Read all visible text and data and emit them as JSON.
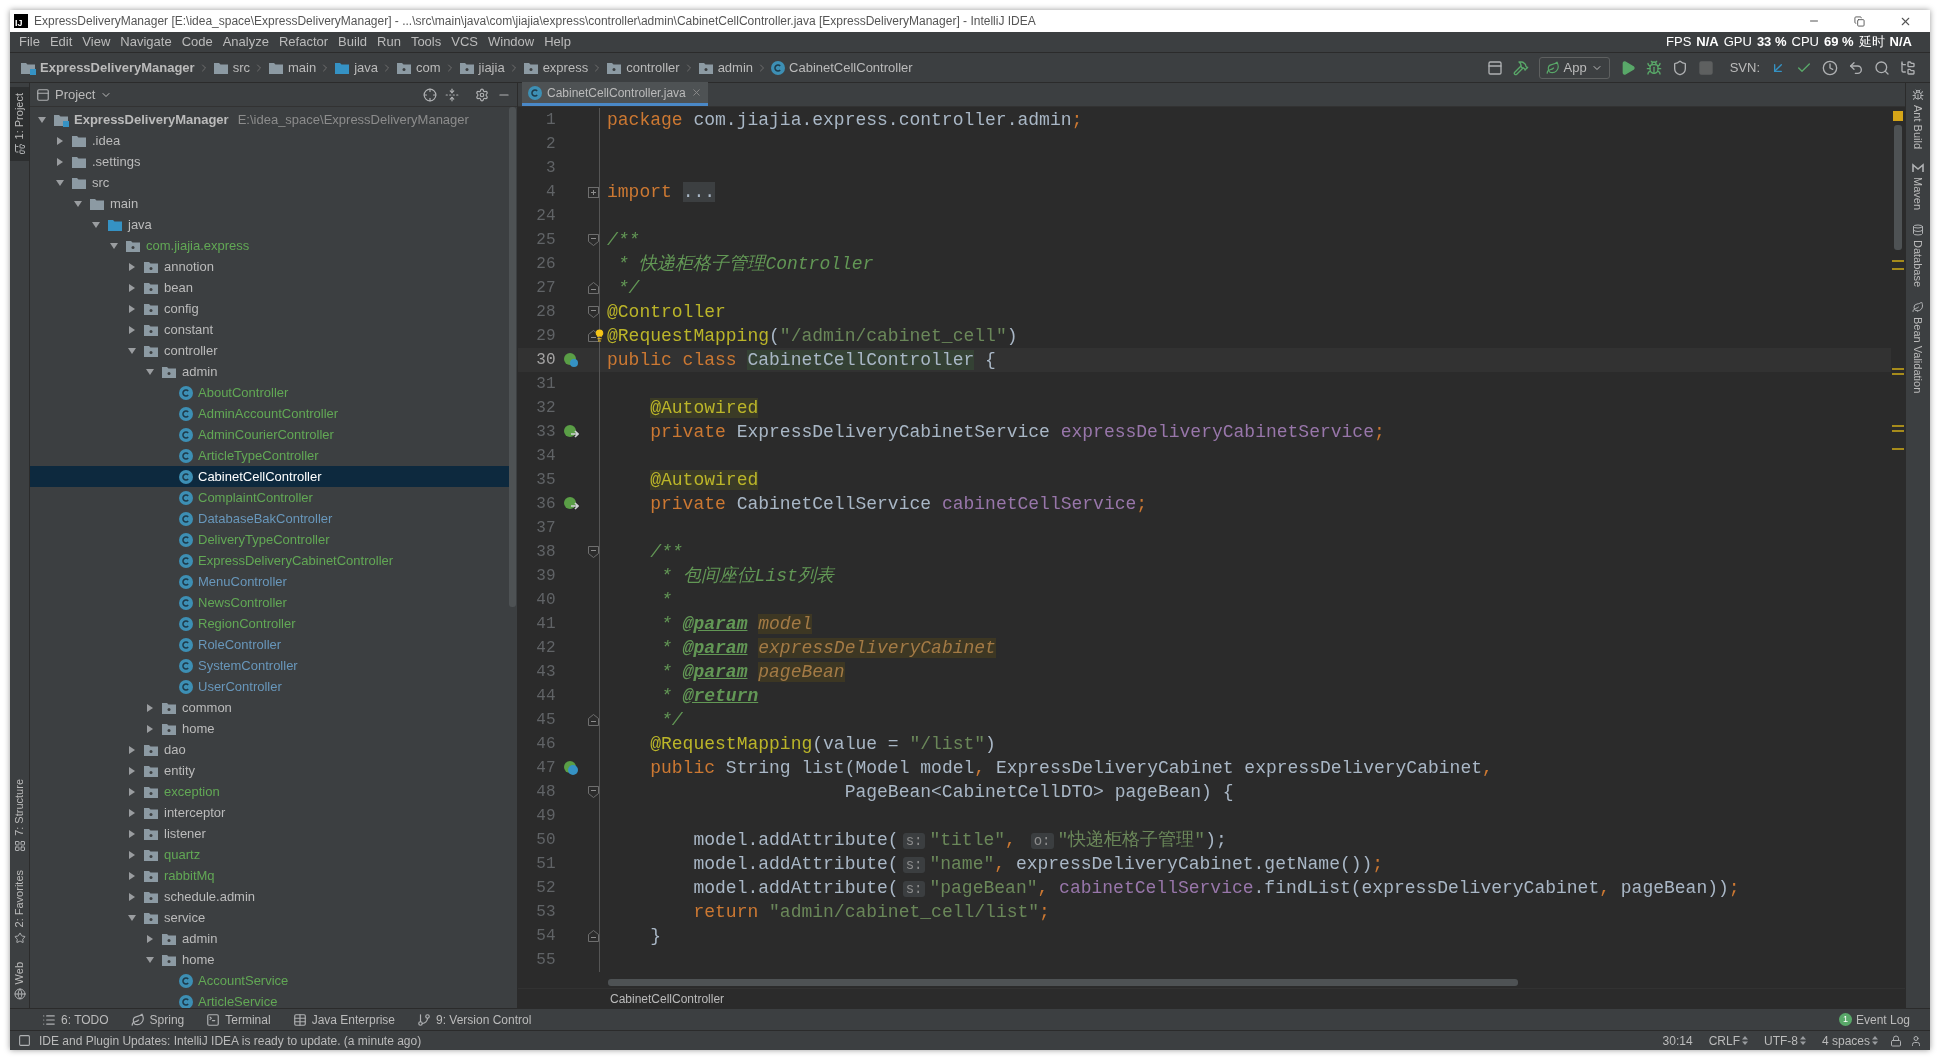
{
  "window": {
    "logo": "IJ",
    "title": "ExpressDeliveryManager [E:\\idea_space\\ExpressDeliveryManager] - ...\\src\\main\\java\\com\\jiajia\\express\\controller\\admin\\CabinetCellController.java [ExpressDeliveryManager] - IntelliJ IDEA"
  },
  "menu": [
    "File",
    "Edit",
    "View",
    "Navigate",
    "Code",
    "Analyze",
    "Refactor",
    "Build",
    "Run",
    "Tools",
    "VCS",
    "Window",
    "Help"
  ],
  "perf": [
    {
      "label": "FPS",
      "value": "N/A"
    },
    {
      "label": "GPU",
      "value": "33 %"
    },
    {
      "label": "CPU",
      "value": "69 %"
    },
    {
      "label": "延时",
      "value": "N/A"
    }
  ],
  "breadcrumbs": [
    {
      "label": "ExpressDeliveryManager",
      "kind": "module"
    },
    {
      "label": "src",
      "kind": "folder"
    },
    {
      "label": "main",
      "kind": "folder"
    },
    {
      "label": "java",
      "kind": "source"
    },
    {
      "label": "com",
      "kind": "package"
    },
    {
      "label": "jiajia",
      "kind": "package"
    },
    {
      "label": "express",
      "kind": "package"
    },
    {
      "label": "controller",
      "kind": "package"
    },
    {
      "label": "admin",
      "kind": "package"
    },
    {
      "label": "CabinetCellController",
      "kind": "class"
    }
  ],
  "toolbar": {
    "run_config": "App",
    "svn_label": "SVN:"
  },
  "left_tools": [
    {
      "label": "1: Project",
      "kind": "project",
      "selected": true
    },
    {
      "label": "7: Structure",
      "kind": "structure",
      "selected": false
    },
    {
      "label": "2: Favorites",
      "kind": "favorites",
      "selected": false
    },
    {
      "label": "Web",
      "kind": "web",
      "selected": false
    }
  ],
  "right_tools": [
    {
      "label": "Ant Build",
      "kind": "ant"
    },
    {
      "label": "Maven",
      "kind": "maven"
    },
    {
      "label": "Database",
      "kind": "database"
    },
    {
      "label": "Bean Validation",
      "kind": "bean"
    }
  ],
  "project_panel": {
    "title": "Project",
    "tree": [
      {
        "label": "ExpressDeliveryManager",
        "path": "E:\\idea_space\\ExpressDeliveryManager",
        "kind": "module",
        "color": "#bbbbbb",
        "selected": false,
        "expanded": true,
        "children": [
          {
            "label": ".idea",
            "kind": "folder",
            "color": "#bbbbbb",
            "selected": false,
            "expanded": false
          },
          {
            "label": ".settings",
            "kind": "folder",
            "color": "#bbbbbb",
            "selected": false,
            "expanded": false
          },
          {
            "label": "src",
            "kind": "folder",
            "color": "#bbbbbb",
            "selected": false,
            "expanded": true,
            "children": [
              {
                "label": "main",
                "kind": "folder",
                "color": "#bbbbbb",
                "selected": false,
                "expanded": true,
                "children": [
                  {
                    "label": "java",
                    "kind": "source",
                    "color": "#bbbbbb",
                    "selected": false,
                    "expanded": true,
                    "children": [
                      {
                        "label": "com.jiajia.express",
                        "kind": "package",
                        "color": "#62a855",
                        "selected": false,
                        "expanded": true,
                        "children": [
                          {
                            "label": "annotion",
                            "kind": "package",
                            "color": "#bbbbbb",
                            "selected": false,
                            "expanded": false
                          },
                          {
                            "label": "bean",
                            "kind": "package",
                            "color": "#bbbbbb",
                            "selected": false,
                            "expanded": false
                          },
                          {
                            "label": "config",
                            "kind": "package",
                            "color": "#bbbbbb",
                            "selected": false,
                            "expanded": false
                          },
                          {
                            "label": "constant",
                            "kind": "package",
                            "color": "#bbbbbb",
                            "selected": false,
                            "expanded": false
                          },
                          {
                            "label": "controller",
                            "kind": "package",
                            "color": "#bbbbbb",
                            "selected": false,
                            "expanded": true,
                            "children": [
                              {
                                "label": "admin",
                                "kind": "package",
                                "color": "#bbbbbb",
                                "selected": false,
                                "expanded": true,
                                "children": [
                                  {
                                    "label": "AboutController",
                                    "kind": "class",
                                    "color": "#62a855",
                                    "selected": false
                                  },
                                  {
                                    "label": "AdminAccountController",
                                    "kind": "class",
                                    "color": "#62a855",
                                    "selected": false
                                  },
                                  {
                                    "label": "AdminCourierController",
                                    "kind": "class",
                                    "color": "#62a855",
                                    "selected": false
                                  },
                                  {
                                    "label": "ArticleTypeController",
                                    "kind": "class",
                                    "color": "#62a855",
                                    "selected": false
                                  },
                                  {
                                    "label": "CabinetCellController",
                                    "kind": "class",
                                    "selected": true
                                  },
                                  {
                                    "label": "ComplaintController",
                                    "kind": "class",
                                    "color": "#62a855",
                                    "selected": false
                                  },
                                  {
                                    "label": "DatabaseBakController",
                                    "kind": "class",
                                    "color": "#6897bb",
                                    "selected": false
                                  },
                                  {
                                    "label": "DeliveryTypeController",
                                    "kind": "class",
                                    "color": "#62a855",
                                    "selected": false
                                  },
                                  {
                                    "label": "ExpressDeliveryCabinetController",
                                    "kind": "class",
                                    "color": "#62a855",
                                    "selected": false
                                  },
                                  {
                                    "label": "MenuController",
                                    "kind": "class",
                                    "color": "#6897bb",
                                    "selected": false
                                  },
                                  {
                                    "label": "NewsController",
                                    "kind": "class",
                                    "color": "#62a855",
                                    "selected": false
                                  },
                                  {
                                    "label": "RegionController",
                                    "kind": "class",
                                    "color": "#62a855",
                                    "selected": false
                                  },
                                  {
                                    "label": "RoleController",
                                    "kind": "class",
                                    "color": "#6897bb",
                                    "selected": false
                                  },
                                  {
                                    "label": "SystemController",
                                    "kind": "class",
                                    "color": "#6897bb",
                                    "selected": false
                                  },
                                  {
                                    "label": "UserController",
                                    "kind": "class",
                                    "color": "#6897bb",
                                    "selected": false
                                  }
                                ]
                              },
                              {
                                "label": "common",
                                "kind": "package",
                                "color": "#bbbbbb",
                                "selected": false,
                                "expanded": false
                              },
                              {
                                "label": "home",
                                "kind": "package",
                                "color": "#bbbbbb",
                                "selected": false,
                                "expanded": false
                              }
                            ]
                          },
                          {
                            "label": "dao",
                            "kind": "package",
                            "color": "#bbbbbb",
                            "selected": false,
                            "expanded": false
                          },
                          {
                            "label": "entity",
                            "kind": "package",
                            "color": "#bbbbbb",
                            "selected": false,
                            "expanded": false
                          },
                          {
                            "label": "exception",
                            "kind": "package",
                            "color": "#62a855",
                            "selected": false,
                            "expanded": false
                          },
                          {
                            "label": "interceptor",
                            "kind": "package",
                            "color": "#bbbbbb",
                            "selected": false,
                            "expanded": false
                          },
                          {
                            "label": "listener",
                            "kind": "package",
                            "color": "#bbbbbb",
                            "selected": false,
                            "expanded": false
                          },
                          {
                            "label": "quartz",
                            "kind": "package",
                            "color": "#62a855",
                            "selected": false,
                            "expanded": false
                          },
                          {
                            "label": "rabbitMq",
                            "kind": "package",
                            "color": "#62a855",
                            "selected": false,
                            "expanded": false
                          },
                          {
                            "label": "schedule.admin",
                            "kind": "package",
                            "color": "#bbbbbb",
                            "selected": false,
                            "expanded": false
                          },
                          {
                            "label": "service",
                            "kind": "package",
                            "color": "#bbbbbb",
                            "selected": false,
                            "expanded": true,
                            "children": [
                              {
                                "label": "admin",
                                "kind": "package",
                                "color": "#bbbbbb",
                                "selected": false,
                                "expanded": false
                              },
                              {
                                "label": "home",
                                "kind": "package",
                                "color": "#bbbbbb",
                                "selected": false,
                                "expanded": true,
                                "children": [
                                  {
                                    "label": "AccountService",
                                    "kind": "class",
                                    "color": "#62a855",
                                    "selected": false
                                  },
                                  {
                                    "label": "ArticleService",
                                    "kind": "class",
                                    "color": "#62a855",
                                    "selected": false
                                  }
                                ]
                              }
                            ]
                          }
                        ]
                      }
                    ]
                  }
                ]
              }
            ]
          }
        ]
      }
    ]
  },
  "editor_tabs": [
    {
      "label": "CabinetCellController.java",
      "selected": true
    }
  ],
  "code": {
    "lines": [
      {
        "number": "1",
        "current": false,
        "tokens": [
          {
            "text": "package ",
            "kind": "kw"
          },
          {
            "text": "com.jiajia.express.controller.admin",
            "kind": "plain"
          },
          {
            "text": ";",
            "kind": "kw"
          }
        ]
      },
      {
        "number": "2",
        "current": false
      },
      {
        "number": "3",
        "current": false
      },
      {
        "number": "4",
        "current": false,
        "tokens": [
          {
            "text": "import ",
            "kind": "kw"
          },
          {
            "text": "...",
            "kind": "fold"
          }
        ]
      },
      {
        "number": "24",
        "current": false
      },
      {
        "number": "25",
        "current": false,
        "tokens": [
          {
            "text": "/**",
            "kind": "doc"
          }
        ]
      },
      {
        "number": "26",
        "current": false,
        "tokens": [
          {
            "text": " * 快递柜格子管理Controller",
            "kind": "doc"
          }
        ]
      },
      {
        "number": "27",
        "current": false,
        "tokens": [
          {
            "text": " */",
            "kind": "doc"
          }
        ]
      },
      {
        "number": "28",
        "current": false,
        "tokens": [
          {
            "text": "@Controller",
            "kind": "ann"
          }
        ]
      },
      {
        "number": "29",
        "current": false,
        "tokens": [
          {
            "text": "@RequestMapping",
            "kind": "ann"
          },
          {
            "text": "(",
            "kind": "plain"
          },
          {
            "text": "\"/admin/cabinet_cell\"",
            "kind": "str"
          },
          {
            "text": ")",
            "kind": "plain"
          }
        ]
      },
      {
        "number": "30",
        "current": true,
        "tokens": [
          {
            "text": "public class ",
            "kind": "kw"
          },
          {
            "text": "CabinetCellController",
            "kind": "ident"
          },
          {
            "text": " {",
            "kind": "plain"
          }
        ]
      },
      {
        "number": "31",
        "current": false
      },
      {
        "number": "32",
        "current": false,
        "tokens": [
          {
            "text": "    @Autowired",
            "kind": "annhl"
          }
        ]
      },
      {
        "number": "33",
        "current": false,
        "tokens": [
          {
            "text": "    private ",
            "kind": "kw"
          },
          {
            "text": "ExpressDeliveryCabinetService ",
            "kind": "plain"
          },
          {
            "text": "expressDeliveryCabinetService",
            "kind": "field"
          },
          {
            "text": ";",
            "kind": "kw"
          }
        ]
      },
      {
        "number": "34",
        "current": false
      },
      {
        "number": "35",
        "current": false,
        "tokens": [
          {
            "text": "    @Autowired",
            "kind": "annhl"
          }
        ]
      },
      {
        "number": "36",
        "current": false,
        "tokens": [
          {
            "text": "    private ",
            "kind": "kw"
          },
          {
            "text": "CabinetCellService ",
            "kind": "plain"
          },
          {
            "text": "cabinetCellService",
            "kind": "field"
          },
          {
            "text": ";",
            "kind": "kw"
          }
        ]
      },
      {
        "number": "37",
        "current": false
      },
      {
        "number": "38",
        "current": false,
        "tokens": [
          {
            "text": "    /**",
            "kind": "doc"
          }
        ]
      },
      {
        "number": "39",
        "current": false,
        "tokens": [
          {
            "text": "     * 包间座位List列表",
            "kind": "doc"
          }
        ]
      },
      {
        "number": "40",
        "current": false,
        "tokens": [
          {
            "text": "     *",
            "kind": "doc"
          }
        ]
      },
      {
        "number": "41",
        "current": false,
        "tokens": [
          {
            "text": "     * ",
            "kind": "doc"
          },
          {
            "text": "@param",
            "kind": "doctag"
          },
          {
            "text": " model",
            "kind": "docref"
          }
        ]
      },
      {
        "number": "42",
        "current": false,
        "tokens": [
          {
            "text": "     * ",
            "kind": "doc"
          },
          {
            "text": "@param",
            "kind": "doctag"
          },
          {
            "text": " expressDeliveryCabinet",
            "kind": "docref"
          }
        ]
      },
      {
        "number": "43",
        "current": false,
        "tokens": [
          {
            "text": "     * ",
            "kind": "doc"
          },
          {
            "text": "@param",
            "kind": "doctag"
          },
          {
            "text": " pageBean",
            "kind": "docref"
          }
        ]
      },
      {
        "number": "44",
        "current": false,
        "tokens": [
          {
            "text": "     * ",
            "kind": "doc"
          },
          {
            "text": "@return",
            "kind": "doctag"
          }
        ]
      },
      {
        "number": "45",
        "current": false,
        "tokens": [
          {
            "text": "     */",
            "kind": "doc"
          }
        ]
      },
      {
        "number": "46",
        "current": false,
        "tokens": [
          {
            "text": "    @RequestMapping",
            "kind": "ann"
          },
          {
            "text": "(value = ",
            "kind": "plain"
          },
          {
            "text": "\"/list\"",
            "kind": "str"
          },
          {
            "text": ")",
            "kind": "plain"
          }
        ]
      },
      {
        "number": "47",
        "current": false,
        "tokens": [
          {
            "text": "    public ",
            "kind": "kw"
          },
          {
            "text": "String list(Model model",
            "kind": "plain"
          },
          {
            "text": ", ",
            "kind": "kw"
          },
          {
            "text": "ExpressDeliveryCabinet expressDeliveryCabinet",
            "kind": "plain"
          },
          {
            "text": ",",
            "kind": "kw"
          }
        ]
      },
      {
        "number": "48",
        "current": false,
        "tokens": [
          {
            "text": "                      PageBean<CabinetCellDTO> pageBean) {",
            "kind": "plain"
          }
        ]
      },
      {
        "number": "49",
        "current": false
      },
      {
        "number": "50",
        "current": false,
        "tokens": [
          {
            "text": "        model.addAttribute(",
            "kind": "plain"
          },
          {
            "text": "s:",
            "kind": "hint"
          },
          {
            "text": "\"title\"",
            "kind": "str"
          },
          {
            "text": ", ",
            "kind": "kw"
          },
          {
            "text": "o:",
            "kind": "hint"
          },
          {
            "text": "\"快递柜格子管理\"",
            "kind": "str"
          },
          {
            "text": ");",
            "kind": "plain"
          }
        ]
      },
      {
        "number": "51",
        "current": false,
        "tokens": [
          {
            "text": "        model.addAttribute(",
            "kind": "plain"
          },
          {
            "text": "s:",
            "kind": "hint"
          },
          {
            "text": "\"name\"",
            "kind": "str"
          },
          {
            "text": ", ",
            "kind": "kw"
          },
          {
            "text": "expressDeliveryCabinet.getName())",
            "kind": "plain"
          },
          {
            "text": ";",
            "kind": "kw"
          }
        ]
      },
      {
        "number": "52",
        "current": false,
        "tokens": [
          {
            "text": "        model.addAttribute(",
            "kind": "plain"
          },
          {
            "text": "s:",
            "kind": "hint"
          },
          {
            "text": "\"pageBean\"",
            "kind": "str"
          },
          {
            "text": ", ",
            "kind": "kw"
          },
          {
            "text": "cabinetCellService",
            "kind": "field"
          },
          {
            "text": ".findList(expressDeliveryCabinet",
            "kind": "plain"
          },
          {
            "text": ", ",
            "kind": "kw"
          },
          {
            "text": "pageBean))",
            "kind": "plain"
          },
          {
            "text": ";",
            "kind": "kw"
          }
        ]
      },
      {
        "number": "53",
        "current": false,
        "tokens": [
          {
            "text": "        return ",
            "kind": "kw"
          },
          {
            "text": "\"admin/cabinet_cell/list\"",
            "kind": "str"
          },
          {
            "text": ";",
            "kind": "kw"
          }
        ]
      },
      {
        "number": "54",
        "current": false,
        "tokens": [
          {
            "text": "    }",
            "kind": "plain"
          }
        ]
      },
      {
        "number": "55",
        "current": false
      }
    ]
  },
  "editor_breadcrumb": "CabinetCellController",
  "bottom_tools": [
    {
      "label": "6: TODO",
      "kind": "todo"
    },
    {
      "label": "Spring",
      "kind": "spring"
    },
    {
      "label": "Terminal",
      "kind": "terminal"
    },
    {
      "label": "Java Enterprise",
      "kind": "javaee"
    },
    {
      "label": "9: Version Control",
      "kind": "vcs"
    }
  ],
  "status": {
    "message": "IDE and Plugin Updates: IntelliJ IDEA is ready to update. (a minute ago)",
    "event_count": "1",
    "event_label": "Event Log",
    "items": [
      {
        "label": "30:14",
        "kind": "plain"
      },
      {
        "label": "CRLF",
        "kind": "select"
      },
      {
        "label": "UTF-8",
        "kind": "select"
      },
      {
        "label": "4 spaces",
        "kind": "select"
      }
    ]
  }
}
